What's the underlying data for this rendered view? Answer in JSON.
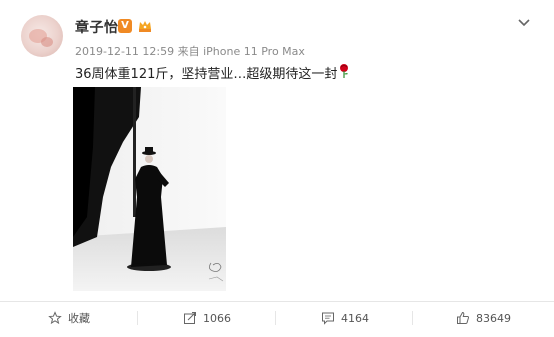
{
  "post": {
    "username": "章子怡",
    "verified_badge": "V",
    "meta": "2019-12-11 12:59 来自 iPhone 11 Pro Max",
    "text": "36周体重121斤，坚持营业…超级期待这一封",
    "text_emoji": "rose-icon"
  },
  "actions": {
    "favorite": "收藏",
    "repost": "1066",
    "comment": "4164",
    "like": "83649"
  },
  "colors": {
    "verified": "#f08a24",
    "meta_text": "#8a8a8a",
    "divider": "#e6e6e6"
  }
}
